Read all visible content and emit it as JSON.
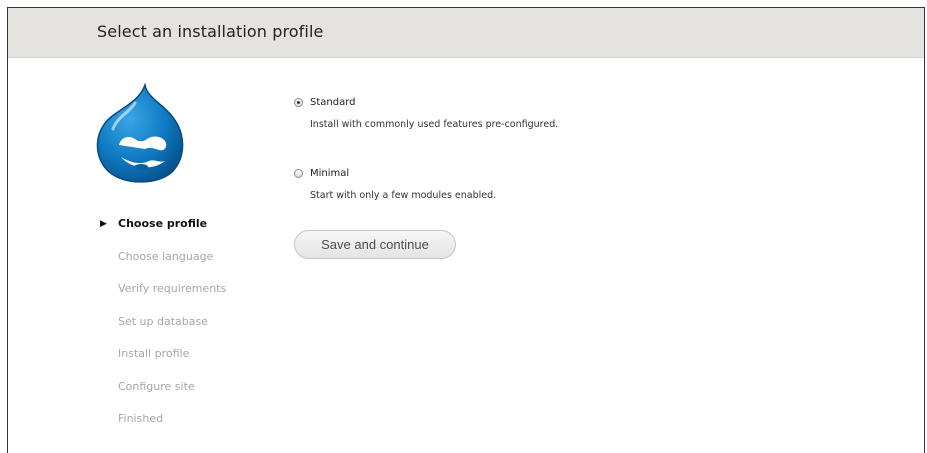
{
  "header": {
    "title": "Select an installation profile"
  },
  "sidebar": {
    "steps": [
      {
        "label": "Choose profile",
        "active": true
      },
      {
        "label": "Choose language",
        "active": false
      },
      {
        "label": "Verify requirements",
        "active": false
      },
      {
        "label": "Set up database",
        "active": false
      },
      {
        "label": "Install profile",
        "active": false
      },
      {
        "label": "Configure site",
        "active": false
      },
      {
        "label": "Finished",
        "active": false
      }
    ],
    "active_marker": "▶"
  },
  "profiles": [
    {
      "label": "Standard",
      "description": "Install with commonly used features pre-configured.",
      "selected": true
    },
    {
      "label": "Minimal",
      "description": "Start with only a few modules enabled.",
      "selected": false
    }
  ],
  "form": {
    "submit_label": "Save and continue"
  },
  "colors": {
    "header_bg": "#e4e3df",
    "drop_blue": "#0f7ac3",
    "active_step": "#111111",
    "inactive_step": "#a6a6a6"
  },
  "icons": {
    "logo": "drupal-drop-logo",
    "active_step": "triangle-right-icon"
  }
}
